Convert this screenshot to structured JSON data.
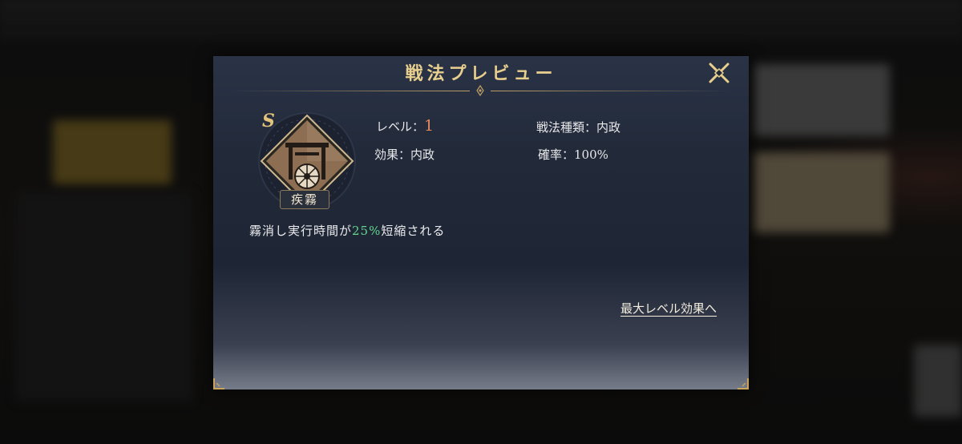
{
  "dialog": {
    "title": "戦法プレビュー",
    "close_icon": "close-x-icon"
  },
  "skill": {
    "rank": "S",
    "name": "疾霧",
    "icon": "gate-wheel-emblem-icon"
  },
  "info": {
    "level_label": "レベル：",
    "level_value": "1",
    "type_label": "戦法種類：",
    "type_value": "内政",
    "effect_label": "効果：",
    "effect_value": "内政",
    "rate_label": "確率：",
    "rate_value": "100%"
  },
  "description": {
    "prefix": "霧消し実行時間が",
    "highlight": "25%",
    "suffix": "短縮される"
  },
  "links": {
    "max_level_effect": "最大レベル効果へ"
  },
  "colors": {
    "title_gold": "#e9cf8e",
    "level_value": "#e38a5e",
    "highlight_green": "#63d68d",
    "panel_bg": "#222a3a"
  }
}
